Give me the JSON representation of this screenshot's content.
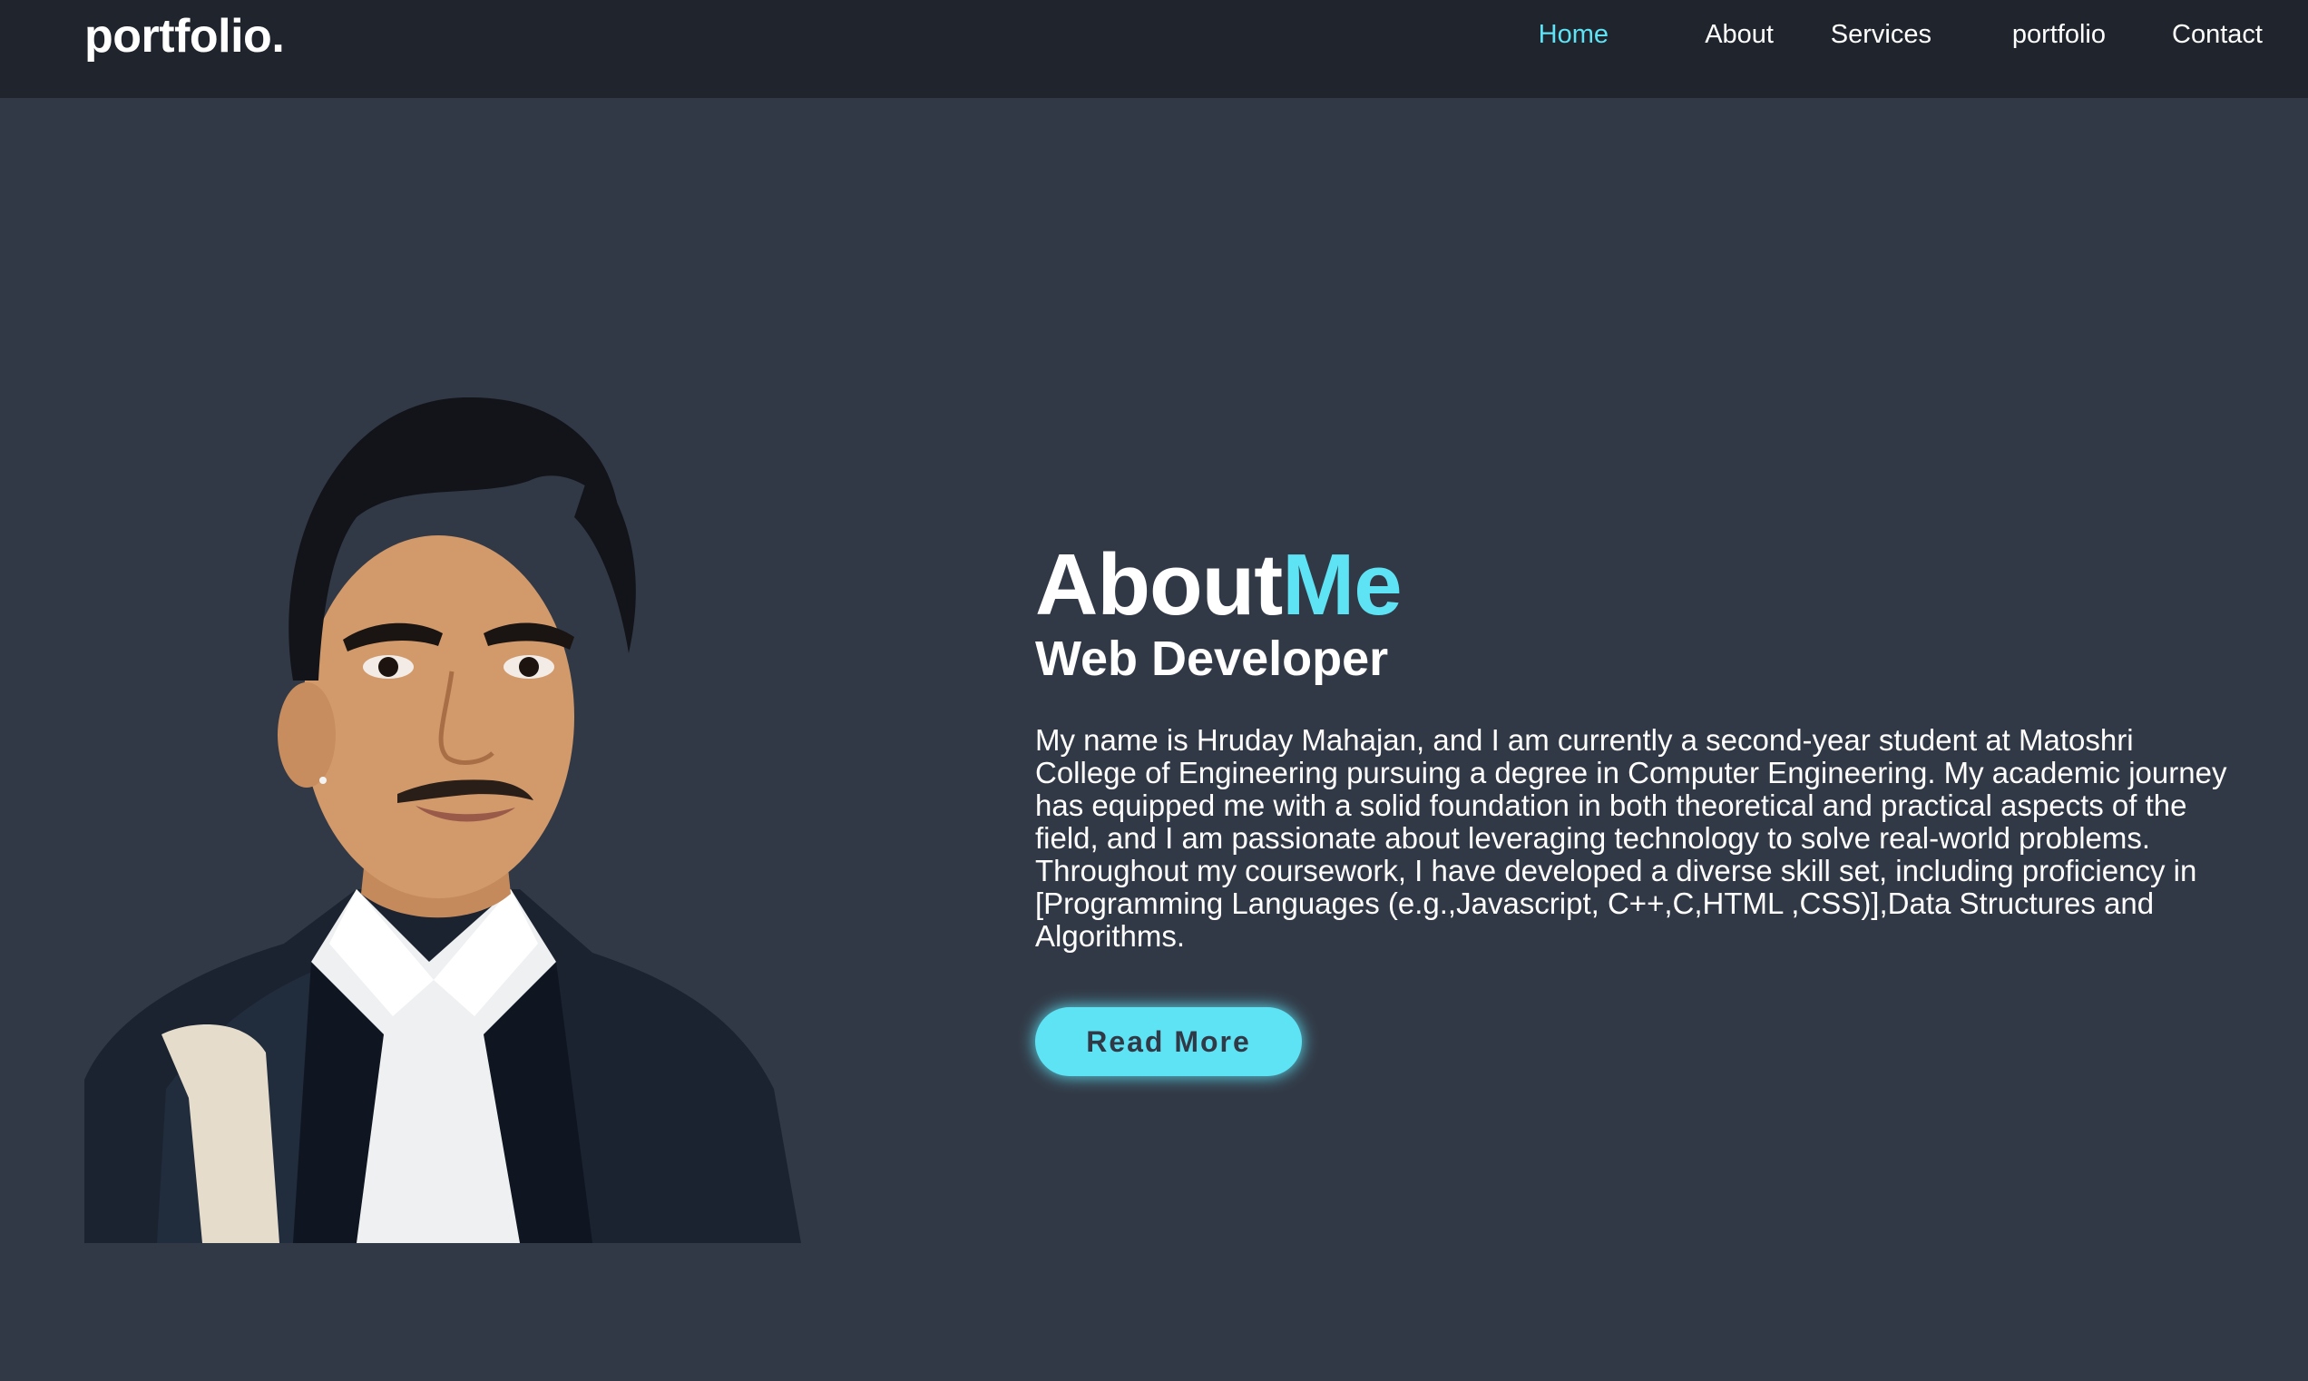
{
  "header": {
    "logo": "portfolio.",
    "nav": [
      {
        "label": "Home",
        "active": true
      },
      {
        "label": "About",
        "active": false
      },
      {
        "label": "Services",
        "active": false
      },
      {
        "label": "portfolio",
        "active": false
      },
      {
        "label": "Contact",
        "active": false
      }
    ]
  },
  "about": {
    "heading_main": "About",
    "heading_accent": "Me",
    "subheading": "Web Developer",
    "paragraph": "My name is Hruday Mahajan, and I am currently a second-year student at Matoshri College of Engineering pursuing a degree in Computer Engineering. My academic journey has equipped me with a solid foundation in both theoretical and practical aspects of the field, and I am passionate about leveraging technology to solve real-world problems. Throughout my coursework, I have developed a diverse skill set, including proficiency in [Programming Languages (e.g.,Javascript, C++,C,HTML ,CSS)],Data Structures and Algorithms.",
    "button_label": "Read More",
    "photo_icon": "profile-photo"
  },
  "colors": {
    "background": "#323946",
    "header_bg": "#1f242d",
    "accent": "#5ee3f5",
    "text": "#ffffff"
  }
}
